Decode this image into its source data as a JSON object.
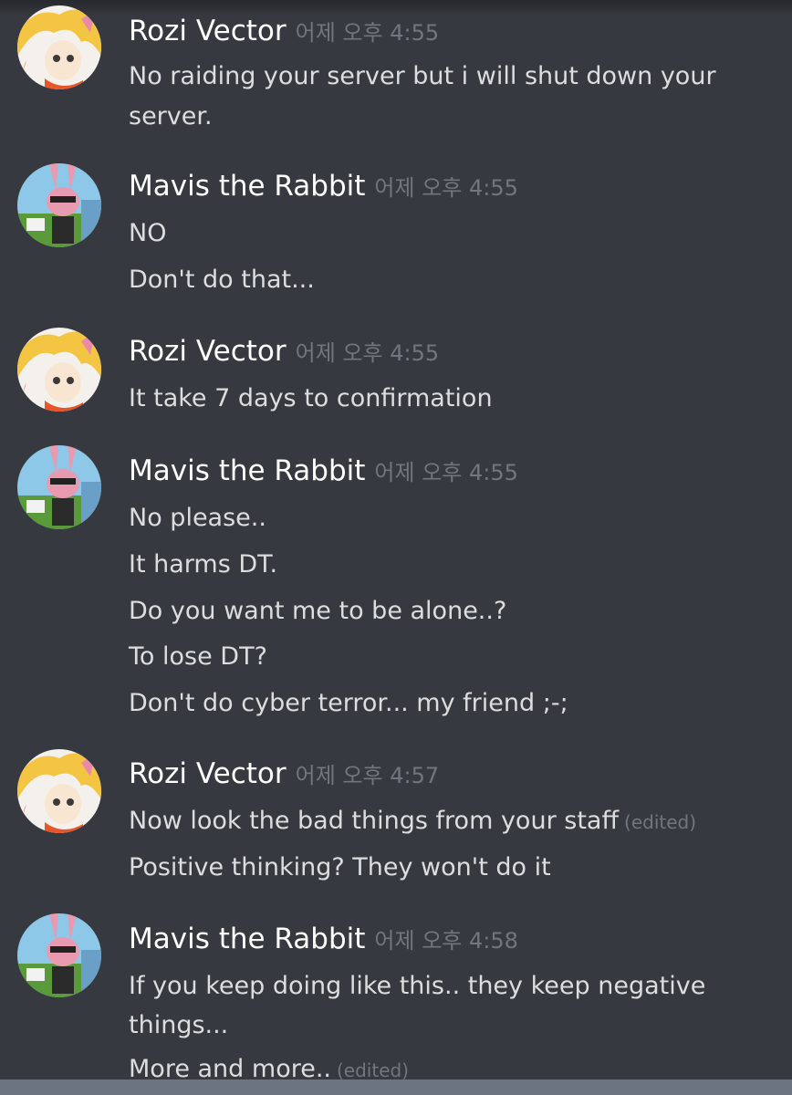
{
  "messages": [
    {
      "user": "Rozi Vector",
      "time": "어제 오후 4:55",
      "avatar": "rozi-avatar",
      "lines": [
        "No raiding your server but i will shut down your",
        "server."
      ]
    },
    {
      "user": "Mavis the Rabbit",
      "time": "어제 오후 4:55",
      "avatar": "mavis-avatar",
      "lines": [
        "NO",
        "Don't do that..."
      ]
    },
    {
      "user": "Rozi Vector",
      "time": "어제 오후 4:55",
      "avatar": "rozi-avatar",
      "lines": [
        "It take 7 days to confirmation"
      ]
    },
    {
      "user": "Mavis the Rabbit",
      "time": "어제 오후 4:55",
      "avatar": "mavis-avatar",
      "lines": [
        "No please..",
        "It harms DT.",
        "Do you want me to be alone..?",
        "To lose DT?",
        "Don't do cyber terror... my friend ;-;"
      ]
    },
    {
      "user": "Rozi Vector",
      "time": "어제 오후 4:57",
      "avatar": "rozi-avatar",
      "lines": [
        "Now look the bad things from your staff",
        "Positive thinking? They won't do it"
      ],
      "edited": "(edited)"
    },
    {
      "user": "Mavis the Rabbit",
      "time": "어제 오후 4:58",
      "avatar": "mavis-avatar",
      "lines": [
        "If you keep doing like this.. they keep negative",
        "things...",
        "More and more.."
      ],
      "edited": "(edited)"
    }
  ],
  "colors": {
    "background": "#36393f",
    "username": "#ffffff",
    "message_text": "#dcddde",
    "timestamp": "#72767d"
  }
}
